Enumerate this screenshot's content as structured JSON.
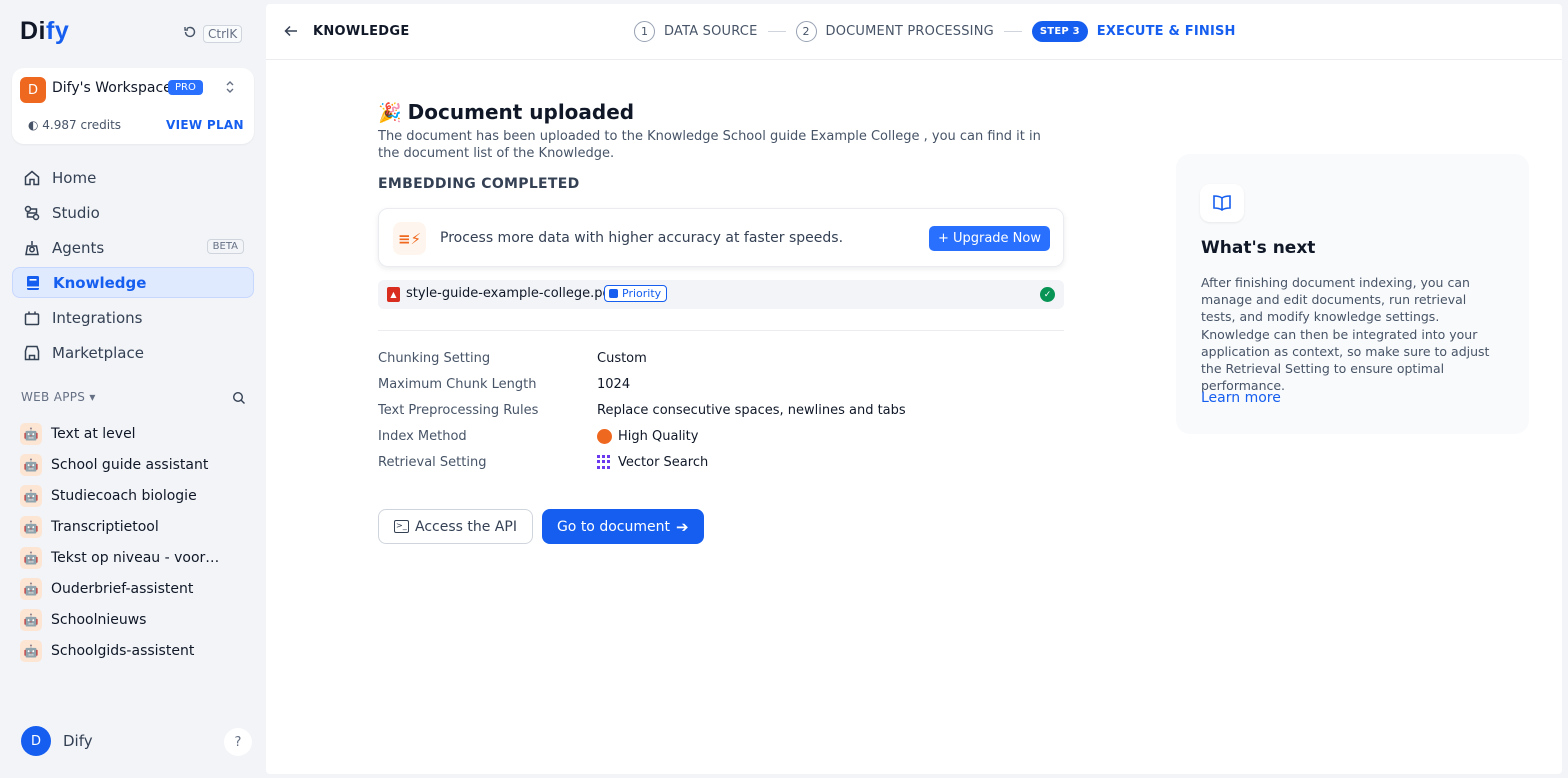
{
  "sidebar": {
    "logo": {
      "part1": "Di",
      "part2": "fy"
    },
    "search_shortcut": "CtrlK",
    "workspace": {
      "avatar_letter": "D",
      "name": "Dify's Workspace",
      "badge": "PRO",
      "credits": "4.987 credits",
      "plan_link": "VIEW PLAN"
    },
    "nav": [
      {
        "label": "Home",
        "icon": "home-icon"
      },
      {
        "label": "Studio",
        "icon": "studio-icon"
      },
      {
        "label": "Agents",
        "icon": "agents-icon",
        "badge": "BETA"
      },
      {
        "label": "Knowledge",
        "icon": "knowledge-icon",
        "active": true
      },
      {
        "label": "Integrations",
        "icon": "integrations-icon"
      },
      {
        "label": "Marketplace",
        "icon": "marketplace-icon"
      }
    ],
    "web_apps_heading": "WEB APPS",
    "web_apps": [
      "Text at level",
      "School guide assistant",
      "Studiecoach biologie",
      "Transcriptietool",
      "Tekst op niveau - voor…",
      "Ouderbrief-assistent",
      "Schoolnieuws",
      "Schoolgids-assistent"
    ],
    "user": {
      "avatar_letter": "D",
      "name": "Dify"
    },
    "help_label": "?"
  },
  "topbar": {
    "back_label": "KNOWLEDGE",
    "steps": [
      {
        "num": "1",
        "label": "DATA SOURCE"
      },
      {
        "num": "2",
        "label": "DOCUMENT PROCESSING"
      }
    ],
    "active_step": {
      "pill": "STEP 3",
      "label": "EXECUTE & FINISH"
    }
  },
  "main": {
    "title": "Document uploaded",
    "description": "The document has been uploaded to the Knowledge School guide Example College , you can find it in the document list of the Knowledge.",
    "embedding_status": "EMBEDDING COMPLETED",
    "upgrade": {
      "text": "Process more data with higher accuracy at faster speeds.",
      "button": "Upgrade Now"
    },
    "file": {
      "name": "style-guide-example-college.pdf",
      "tag": "Priority"
    },
    "settings": [
      {
        "key": "Chunking Setting",
        "value": "Custom"
      },
      {
        "key": "Maximum Chunk Length",
        "value": "1024"
      },
      {
        "key": "Text Preprocessing Rules",
        "value": "Replace consecutive spaces, newlines and tabs"
      },
      {
        "key": "Index Method",
        "value": "High Quality",
        "icon": "high-quality-icon"
      },
      {
        "key": "Retrieval Setting",
        "value": "Vector Search",
        "icon": "vector-search-icon"
      }
    ],
    "buttons": {
      "api": "Access the API",
      "go": "Go to document"
    }
  },
  "whats_next": {
    "title": "What's next",
    "body": "After finishing document indexing, you can manage and edit documents, run retrieval tests, and modify knowledge settings. Knowledge can then be integrated into your application as context, so make sure to adjust the Retrieval Setting to ensure optimal performance.",
    "link": "Learn more"
  },
  "colors": {
    "accent": "#155eef",
    "orange": "#ef6820",
    "success": "#079455"
  }
}
